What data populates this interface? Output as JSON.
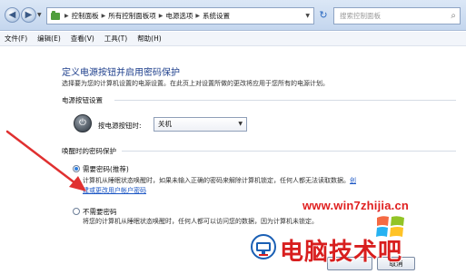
{
  "address_bar": {
    "breadcrumbs": [
      "控制面板",
      "所有控制面板项",
      "电源选项",
      "系统设置"
    ],
    "search_placeholder": "搜索控制面板"
  },
  "menu": [
    "文件(F)",
    "编辑(E)",
    "查看(V)",
    "工具(T)",
    "帮助(H)"
  ],
  "page": {
    "title": "定义电源按钮并启用密码保护",
    "description": "选择要为您的计算机设置的电源设置。在此页上对设置所做的更改将应用于您所有的电源计划。"
  },
  "power_button_section": {
    "label": "电源按钮设置",
    "field_label": "按电源按钮时:",
    "selected_value": "关机"
  },
  "password_section": {
    "label": "唤醒时的密码保护",
    "require_option": {
      "label": "需要密码(推荐)",
      "selected": true,
      "desc_line1": "计算机从睡眠状态唤醒时，如果未输入正确的密码来解除计算机锁定，任何人都无法读取数据。",
      "link_part1": "创",
      "link_part2": "建或更改用户帐户密码"
    },
    "no_require_option": {
      "label": "不需要密码",
      "selected": false,
      "desc_line1": "将您的计算机从睡眠状态唤醒时，任何人都可以访问您的数据，因为计算机未锁定。"
    }
  },
  "buttons": {
    "cancel": "取消"
  },
  "watermark": {
    "url": "www.win7zhijia.cn",
    "brand": "电脑技术吧",
    "logo_text": "W"
  },
  "colors": {
    "title_blue": "#1e3f8c",
    "link_blue": "#1a55c4",
    "arrow_red": "#e03030",
    "watermark_red": "#d81e1e"
  }
}
